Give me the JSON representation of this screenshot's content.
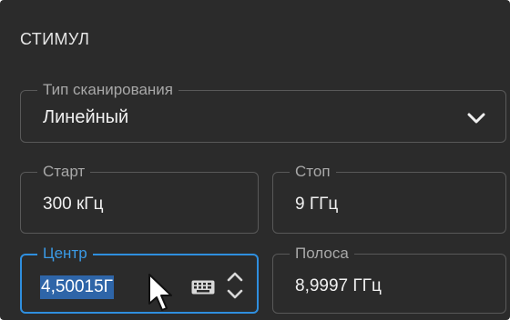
{
  "panel": {
    "title": "СТИМУЛ"
  },
  "scan_type": {
    "label": "Тип сканирования",
    "value": "Линейный",
    "icon": "chevron-down-icon"
  },
  "start": {
    "label": "Старт",
    "value": "300 кГц"
  },
  "stop": {
    "label": "Стоп",
    "value": "9 ГГц"
  },
  "center": {
    "label": "Центр",
    "value": "4,50015Г",
    "keyboard_icon": "keyboard-icon",
    "stepper_icon": "up-down-stepper-icon"
  },
  "span": {
    "label": "Полоса",
    "value": "8,9997 ГГц"
  },
  "colors": {
    "background": "#2b2b2b",
    "accent": "#2f8fdf",
    "selection": "#2e65a8"
  }
}
